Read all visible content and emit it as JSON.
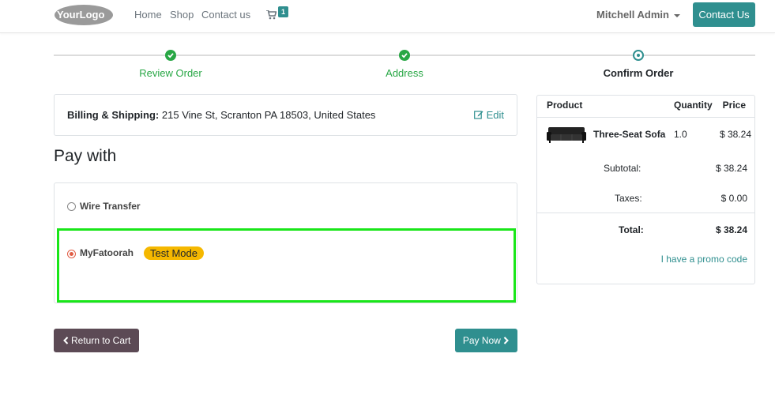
{
  "header": {
    "logo_text": "YourLogo",
    "nav": [
      "Home",
      "Shop",
      "Contact us"
    ],
    "cart_count": "1",
    "user": "Mitchell Admin",
    "contact_button": "Contact Us"
  },
  "progress": {
    "steps": [
      {
        "label": "Review Order",
        "state": "done"
      },
      {
        "label": "Address",
        "state": "done"
      },
      {
        "label": "Confirm Order",
        "state": "current"
      }
    ]
  },
  "address": {
    "label": "Billing & Shipping:",
    "value": "215 Vine St, Scranton PA 18503, United States",
    "edit": "Edit"
  },
  "payment": {
    "title": "Pay with",
    "methods": [
      {
        "label": "Wire Transfer",
        "selected": false
      },
      {
        "label": "MyFatoorah",
        "selected": true,
        "badge": "Test Mode"
      }
    ]
  },
  "actions": {
    "return": "Return to Cart",
    "pay": "Pay Now"
  },
  "summary": {
    "headers": {
      "product": "Product",
      "quantity": "Quantity",
      "price": "Price"
    },
    "items": [
      {
        "name": "Three-Seat Sofa",
        "qty": "1.0",
        "price": "$ 38.24"
      }
    ],
    "subtotal_label": "Subtotal:",
    "subtotal": "$ 38.24",
    "taxes_label": "Taxes:",
    "taxes": "$ 0.00",
    "total_label": "Total:",
    "total": "$ 38.24",
    "promo": "I have a promo code"
  },
  "colors": {
    "primary": "#2f8f8f",
    "success": "#28a745",
    "secondary": "#5c4a55",
    "warning": "#f5b800",
    "highlight": "#19e619"
  }
}
